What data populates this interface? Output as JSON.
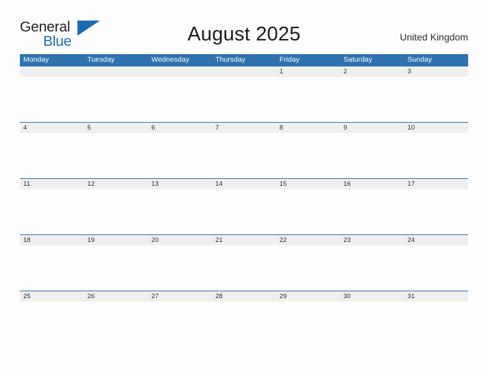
{
  "brand": {
    "line1": "General",
    "line2": "Blue",
    "flag_icon": "blue-flag-triangle",
    "color_dark": "#231f20",
    "color_blue": "#1b6cb5"
  },
  "header": {
    "title": "August 2025",
    "country": "United Kingdom"
  },
  "theme": {
    "header_blue": "#2e72b0",
    "date_band_gray": "#efefef",
    "page_background": "#fdfdfd",
    "rule_blue": "#2e72b0"
  },
  "calendar": {
    "weekdays": [
      "Monday",
      "Tuesday",
      "Wednesday",
      "Thursday",
      "Friday",
      "Saturday",
      "Sunday"
    ],
    "weeks": [
      [
        "",
        "",
        "",
        "",
        "1",
        "2",
        "3"
      ],
      [
        "4",
        "5",
        "6",
        "7",
        "8",
        "9",
        "10"
      ],
      [
        "11",
        "12",
        "13",
        "14",
        "15",
        "16",
        "17"
      ],
      [
        "18",
        "19",
        "20",
        "21",
        "22",
        "23",
        "24"
      ],
      [
        "25",
        "26",
        "27",
        "28",
        "29",
        "30",
        "31"
      ]
    ]
  }
}
